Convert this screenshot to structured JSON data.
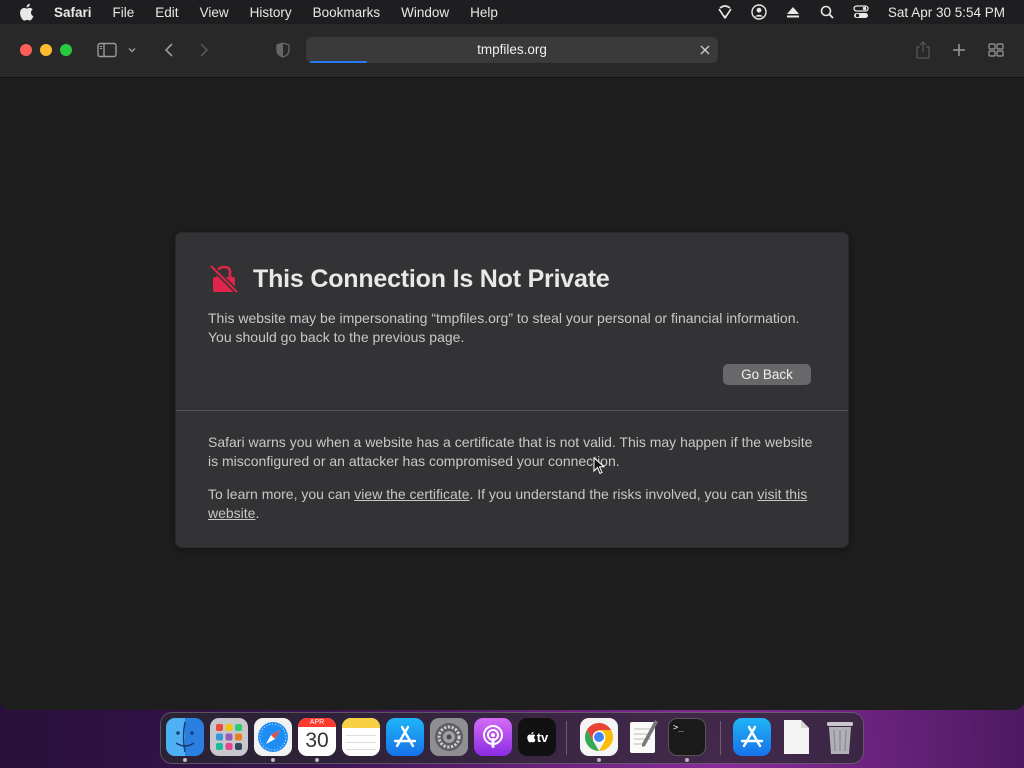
{
  "menubar": {
    "app_name": "Safari",
    "items": [
      "File",
      "Edit",
      "View",
      "History",
      "Bookmarks",
      "Window",
      "Help"
    ],
    "clock": "Sat Apr 30  5:54 PM",
    "status_icons": [
      "wifi-icon",
      "user-icon",
      "eject-icon",
      "spotlight-icon",
      "control-center-icon"
    ]
  },
  "toolbar": {
    "address": "tmpfiles.org",
    "load_progress": 0.14
  },
  "error": {
    "title": "This Connection Is Not Private",
    "message": "This website may be impersonating “tmpfiles.org” to steal your personal or financial information. You should go back to the previous page.",
    "go_back_label": "Go Back",
    "details": "Safari warns you when a website has a certificate that is not valid. This may happen if the website is misconfigured or an attacker has compromised your connection.",
    "learn_prefix": "To learn more, you can ",
    "view_cert_link": "view the certificate",
    "learn_middle": ". If you understand the risks involved, you can ",
    "visit_link": "visit this website",
    "learn_suffix": "."
  },
  "dock": {
    "calendar_month": "APR",
    "calendar_day": "30",
    "tv_label": "tv",
    "terminal_prompt": ">_",
    "apps": [
      "Finder",
      "Launchpad",
      "Safari",
      "Calendar",
      "Notes",
      "App Store",
      "System Preferences",
      "Podcasts",
      "TV",
      "Chrome",
      "TextEdit",
      "Terminal",
      "App Store",
      "Document",
      "Trash"
    ]
  },
  "colors": {
    "accent": "#2b7bf0",
    "warning": "#e0244a",
    "button": "#68686a"
  }
}
